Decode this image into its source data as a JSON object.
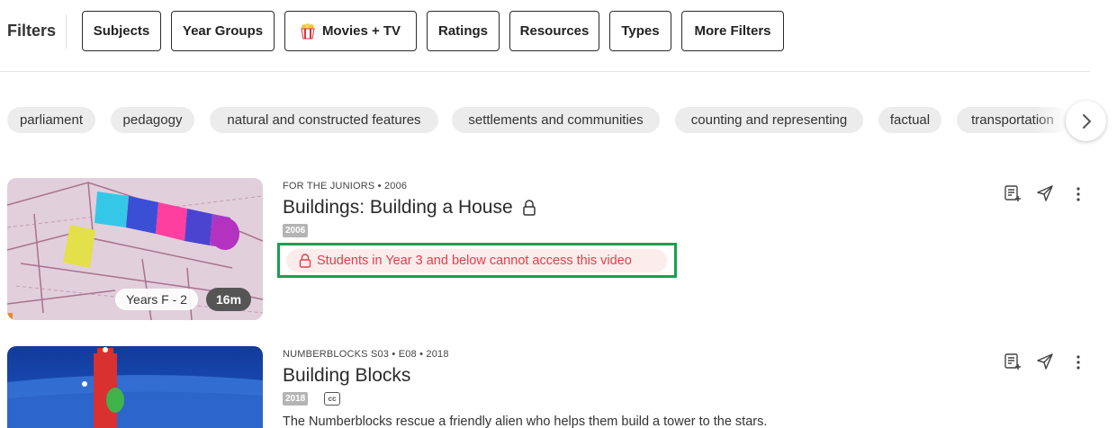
{
  "filters": {
    "label": "Filters",
    "buttons": [
      {
        "label": "Subjects"
      },
      {
        "label": "Year Groups"
      },
      {
        "label": "Movies + TV",
        "icon": "popcorn-icon"
      },
      {
        "label": "Ratings"
      },
      {
        "label": "Resources"
      },
      {
        "label": "Types"
      },
      {
        "label": "More Filters"
      }
    ]
  },
  "tags": [
    "parliament",
    "pedagogy",
    "natural and constructed features",
    "settlements and communities",
    "counting and representing",
    "factual",
    "transportation"
  ],
  "videos": [
    {
      "meta": "FOR THE JUNIORS • 2006",
      "title": "Buildings: Building a House",
      "year_badge": "2006",
      "locked": true,
      "access_notice": "Students in Year 3 and below cannot access this video",
      "years_label": "Years F - 2",
      "duration": "16m"
    },
    {
      "meta": "NUMBERBLOCKS S03 • E08 • 2018",
      "title": "Building Blocks",
      "year_badge": "2018",
      "cc": "cc",
      "description": "The Numberblocks rescue a friendly alien who helps them build a tower to the stars."
    }
  ],
  "colors": {
    "access_text": "#e0404a",
    "access_bg": "#fdecec",
    "highlight_border": "#18a050"
  }
}
